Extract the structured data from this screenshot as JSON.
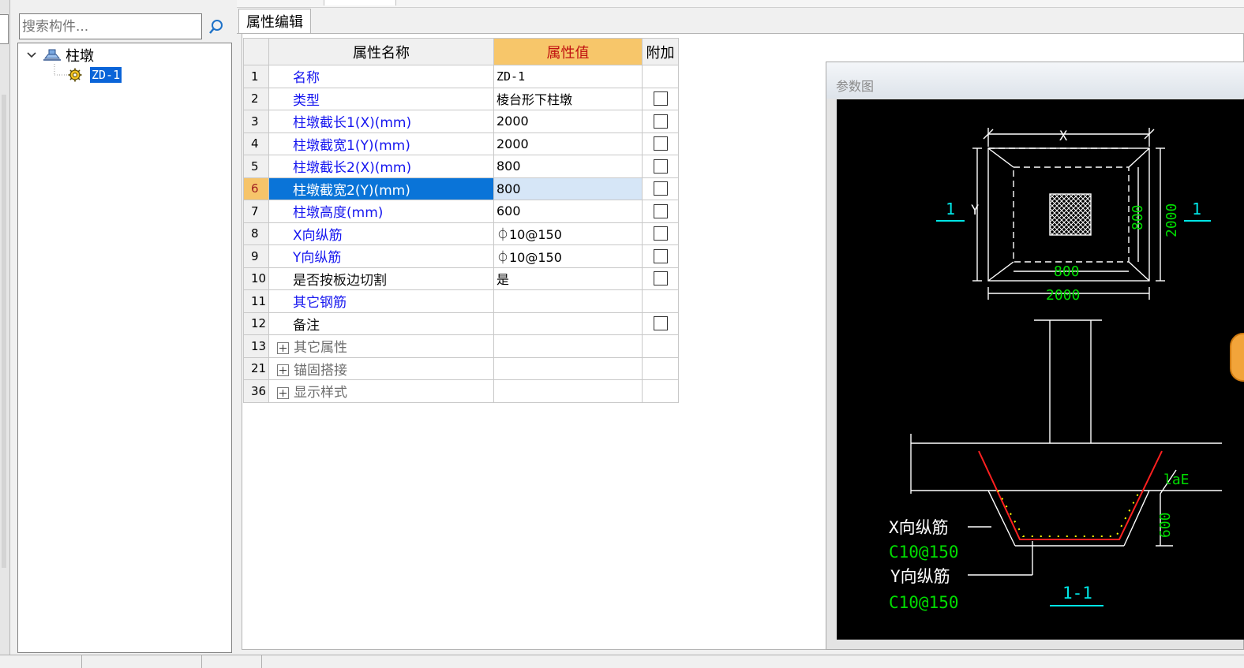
{
  "search": {
    "placeholder": "搜索构件..."
  },
  "tree": {
    "root": {
      "label": "柱墩"
    },
    "child": {
      "label": "ZD-1"
    }
  },
  "tab": {
    "label": "属性编辑"
  },
  "table": {
    "headers": {
      "name": "属性名称",
      "value": "属性值",
      "extra": "附加"
    },
    "rows": [
      {
        "num": "1",
        "name": "名称",
        "value": "ZD-1",
        "check": false
      },
      {
        "num": "2",
        "name": "类型",
        "value": "棱台形下柱墩",
        "check": true
      },
      {
        "num": "3",
        "name": "柱墩截长1(X)(mm)",
        "value": "2000",
        "check": true
      },
      {
        "num": "4",
        "name": "柱墩截宽1(Y)(mm)",
        "value": "2000",
        "check": true
      },
      {
        "num": "5",
        "name": "柱墩截长2(X)(mm)",
        "value": "800",
        "check": true
      },
      {
        "num": "6",
        "name": "柱墩截宽2(Y)(mm)",
        "value": "800",
        "check": true
      },
      {
        "num": "7",
        "name": "柱墩高度(mm)",
        "value": "600",
        "check": true
      },
      {
        "num": "8",
        "name": "X向纵筋",
        "value": "⏀10@150",
        "check": true
      },
      {
        "num": "9",
        "name": "Y向纵筋",
        "value": "⏀10@150",
        "check": true
      },
      {
        "num": "10",
        "name": "是否按板边切割",
        "value": "是",
        "check": true
      },
      {
        "num": "11",
        "name": "其它钢筋",
        "value": "",
        "check": false
      },
      {
        "num": "12",
        "name": "备注",
        "value": "",
        "check": true
      },
      {
        "num": "13",
        "name": "其它属性",
        "value": "",
        "check": false
      },
      {
        "num": "21",
        "name": "锚固搭接",
        "value": "",
        "check": false
      },
      {
        "num": "36",
        "name": "显示样式",
        "value": "",
        "check": false
      }
    ]
  },
  "diagram": {
    "title": "参数图",
    "labels": {
      "x": "X",
      "y": "Y",
      "d800_h": "800",
      "d800_v": "800",
      "d2000_h": "2000",
      "d2000_v": "2000",
      "sec_left": "1",
      "sec_right": "1",
      "lae": "laE",
      "h600": "600",
      "x_rebar": "X向纵筋",
      "x_rebar_val": "C10@150",
      "y_rebar": "Y向纵筋",
      "y_rebar_val": "C10@150",
      "section": "1-1"
    }
  },
  "colors": {
    "selection_blue": "#0a74d8",
    "header_orange": "#f7c66a",
    "label_blue": "#1515ef",
    "cad_green": "#00dd00",
    "cad_cyan": "#00e5e5",
    "cad_red": "#ff2020"
  }
}
